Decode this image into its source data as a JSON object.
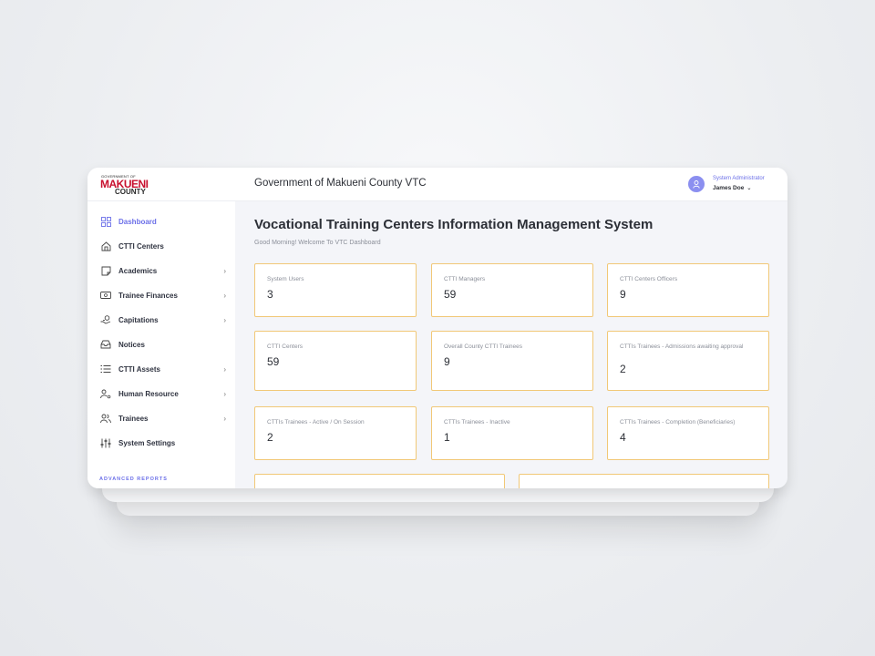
{
  "header": {
    "logo": {
      "line1": "GOVERNMENT OF",
      "line2": "MAKUENI",
      "line3": "COUNTY"
    },
    "app_title": "Government of Makueni County VTC",
    "user": {
      "role": "System Administrator",
      "name": "James Doe"
    }
  },
  "sidebar": {
    "items": [
      {
        "label": "Dashboard",
        "icon": "grid-icon",
        "active": true,
        "has_submenu": false
      },
      {
        "label": "CTTI Centers",
        "icon": "home-icon",
        "has_submenu": false
      },
      {
        "label": "Academics",
        "icon": "note-icon",
        "has_submenu": true
      },
      {
        "label": "Trainee Finances",
        "icon": "money-icon",
        "has_submenu": true
      },
      {
        "label": "Capitations",
        "icon": "hand-coin-icon",
        "has_submenu": true
      },
      {
        "label": "Notices",
        "icon": "inbox-icon",
        "has_submenu": false
      },
      {
        "label": "CTTI Assets",
        "icon": "list-icon",
        "has_submenu": true
      },
      {
        "label": "Human Resource",
        "icon": "user-settings-icon",
        "has_submenu": true
      },
      {
        "label": "Trainees",
        "icon": "users-icon",
        "has_submenu": true
      },
      {
        "label": "System Settings",
        "icon": "sliders-icon",
        "has_submenu": false
      }
    ],
    "section_label": "ADVANCED REPORTS"
  },
  "main": {
    "title": "Vocational Training Centers Information Management System",
    "greeting": "Good Morning! Welcome To VTC Dashboard",
    "cards": [
      {
        "label": "System Users",
        "value": "3"
      },
      {
        "label": "CTTI Managers",
        "value": "59"
      },
      {
        "label": "CTTI Centers Officers",
        "value": "9"
      },
      {
        "label": "CTTI Centers",
        "value": "59"
      },
      {
        "label": "Overall County CTTI Trainees",
        "value": "9"
      },
      {
        "label": "CTTIs Trainees - Admissions awaiting approval",
        "value": "2"
      },
      {
        "label": "CTTIs Trainees - Active / On Session",
        "value": "2"
      },
      {
        "label": "CTTIs Trainees - Inactive",
        "value": "1"
      },
      {
        "label": "CTTIs Trainees - Completion (Beneficiaries)",
        "value": "4"
      }
    ]
  },
  "colors": {
    "accent": "#6b6fe8",
    "card_border": "#f1c877",
    "brand_red": "#c8102e"
  }
}
